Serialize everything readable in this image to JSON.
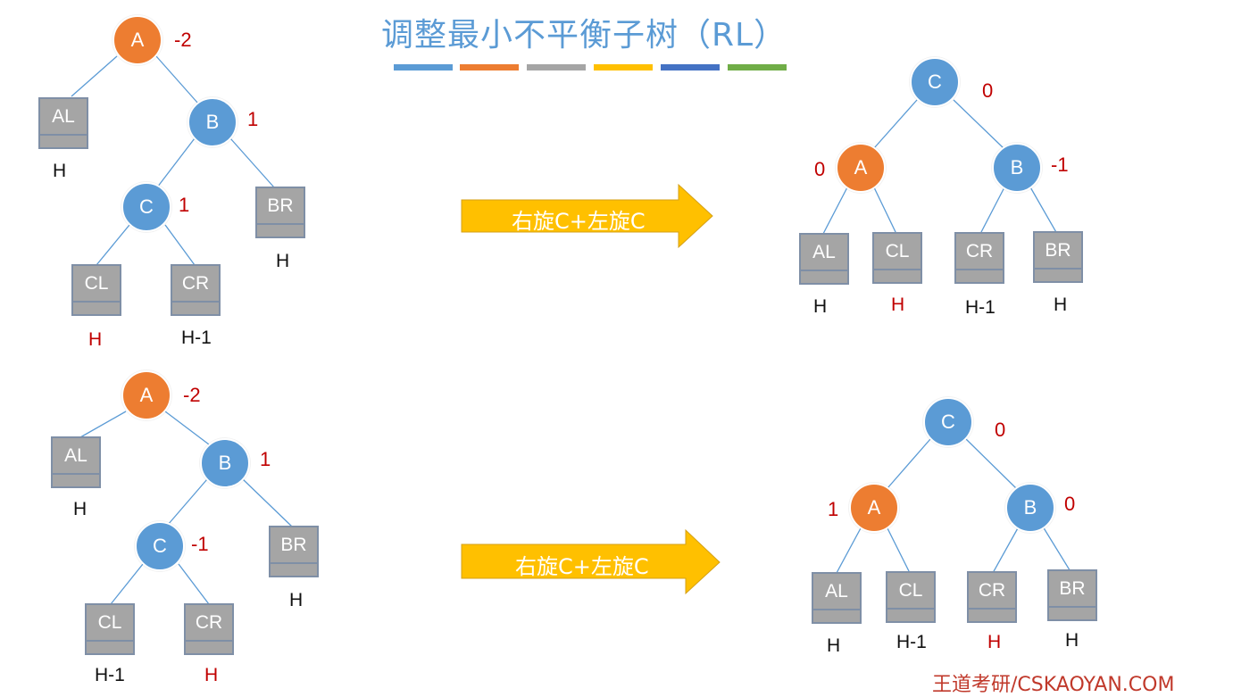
{
  "title": "调整最小不平衡子树（RL）",
  "colors": {
    "node_blue": "#5b9bd5",
    "node_orange": "#ed7d31",
    "box_gray": "#a5a5a5",
    "arrow_fill": "#ffc000",
    "balance_red": "#c00000",
    "title_blue": "#5b9bd5"
  },
  "color_bars": [
    "#5b9bd5",
    "#ed7d31",
    "#a5a5a5",
    "#ffc000",
    "#4472c4",
    "#70ad47"
  ],
  "arrows": [
    {
      "label": "右旋C+左旋C"
    },
    {
      "label": "右旋C+左旋C"
    }
  ],
  "diagrams": {
    "top_before": {
      "nodes": {
        "A": "A",
        "B": "B",
        "C": "C"
      },
      "balance": {
        "A": "-2",
        "B": "1",
        "C": "1"
      },
      "subtrees": {
        "AL": "AL",
        "BR": "BR",
        "CL": "CL",
        "CR": "CR"
      },
      "heights": {
        "AL": "H",
        "BR": "H",
        "CL": "H",
        "CR": "H-1"
      }
    },
    "top_after": {
      "nodes": {
        "C": "C",
        "A": "A",
        "B": "B"
      },
      "balance": {
        "C": "0",
        "A": "0",
        "B": "-1"
      },
      "subtrees": {
        "AL": "AL",
        "CL": "CL",
        "CR": "CR",
        "BR": "BR"
      },
      "heights": {
        "AL": "H",
        "CL": "H",
        "CR": "H-1",
        "BR": "H"
      }
    },
    "bottom_before": {
      "nodes": {
        "A": "A",
        "B": "B",
        "C": "C"
      },
      "balance": {
        "A": "-2",
        "B": "1",
        "C": "-1"
      },
      "subtrees": {
        "AL": "AL",
        "BR": "BR",
        "CL": "CL",
        "CR": "CR"
      },
      "heights": {
        "AL": "H",
        "BR": "H",
        "CL": "H-1",
        "CR": "H"
      }
    },
    "bottom_after": {
      "nodes": {
        "C": "C",
        "A": "A",
        "B": "B"
      },
      "balance": {
        "C": "0",
        "A": "1",
        "B": "0"
      },
      "subtrees": {
        "AL": "AL",
        "CL": "CL",
        "CR": "CR",
        "BR": "BR"
      },
      "heights": {
        "AL": "H",
        "CL": "H-1",
        "CR": "H",
        "BR": "H"
      }
    }
  },
  "footer": "王道考研/CSKAOYAN.COM"
}
